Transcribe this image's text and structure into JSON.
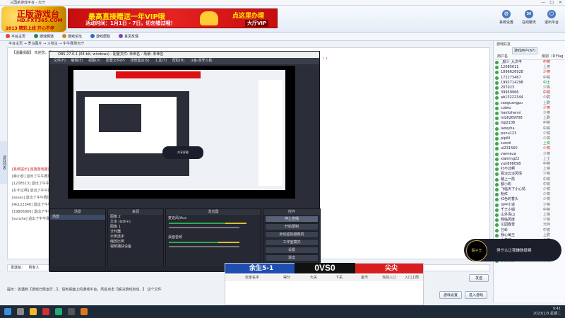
{
  "window": {
    "title": "三国杀游戏平台 - 大厅"
  },
  "logo": {
    "line1": "正版游戏台",
    "line2": "HD.FXT365.COM",
    "line3": "2013 精彩上线 开心不停"
  },
  "banner": {
    "headline": "最高直接赠送一年VIP哦",
    "subline": "活动时间：1月1日 - 7日，切勿错过哦！",
    "cta": "点这里办理",
    "cta2": "大厅VIP"
  },
  "toolbar": [
    {
      "label": "系统设置",
      "icon": "gear-icon"
    },
    {
      "label": "在线聊天",
      "icon": "chat-icon"
    },
    {
      "label": "退出平台",
      "icon": "power-icon"
    }
  ],
  "nav_tabs": [
    {
      "label": "平台主页",
      "color": "#e04a2a"
    },
    {
      "label": "游戏频道",
      "color": "#2a8a3a"
    },
    {
      "label": "游戏论坛",
      "color": "#d28a1a"
    },
    {
      "label": "游戏帮助",
      "color": "#2a6ad2"
    },
    {
      "label": "意见反馈",
      "color": "#8a3ac2"
    }
  ],
  "room": {
    "path": "平台主页 → 罗马图片 → 斗地主 → 牛牛赛场大厅"
  },
  "chat": {
    "notice": "【温馨提醒】 欢迎您，请多多支持我们的游戏平台",
    "red_notice": "请点击进入游戏房间入口！！！！",
    "lines": [
      "[系统提示] 连接游戏服务器成功",
      "[峰小影] 退出了牛牛赛场",
      "[1208513] 退出了牛牛赛场",
      "[打不过啊] 退出了牛牛赛场",
      "[sexes] 退出了牛牛赛场",
      "[4k122346] 退出了牛牛赛场",
      "[19806966] 退出了牛牛赛场",
      "[sunzhe] 退出了牛牛赛场"
    ],
    "input_label": "发送给：",
    "input_value": "所有人",
    "send": "发送",
    "tips": "提示：如遇到【游戏已经运行...】，请到桌面上的游戏平台，然后点击【解决游戏启动...】 这个文件",
    "set_button": "游戏设置",
    "help_button": "进入游戏"
  },
  "collapse_tab": "游戏列表",
  "right_panel": {
    "title": "游戏好友",
    "tabs": [
      "游戏用户(67)"
    ],
    "head": [
      "用户名",
      "级别",
      "ID",
      "Flag"
    ],
    "users": [
      {
        "name": "_颜少_九次丰",
        "level": "中将",
        "tone": "red"
      },
      {
        "name": "12085011",
        "level": "上将",
        "tone": ""
      },
      {
        "name": "1896626928",
        "level": "少将",
        "tone": "red"
      },
      {
        "name": "172273467",
        "level": "中将",
        "tone": ""
      },
      {
        "name": "1992714298",
        "level": "中士",
        "tone": "grn"
      },
      {
        "name": "207023",
        "level": "少将",
        "tone": ""
      },
      {
        "name": "39959966",
        "level": "中将",
        "tone": "red"
      },
      {
        "name": "ab13222344",
        "level": "少尉",
        "tone": ""
      },
      {
        "name": "caoguangpu",
        "level": "上尉",
        "tone": ""
      },
      {
        "name": "cuiwu",
        "level": "少将",
        "tone": "red"
      },
      {
        "name": "hanlizhenni",
        "level": "少将",
        "tone": ""
      },
      {
        "name": "hrb6269708",
        "level": "上尉",
        "tone": ""
      },
      {
        "name": "liqi2108",
        "level": "中将",
        "tone": ""
      },
      {
        "name": "laoxyha",
        "level": "中将",
        "tone": ""
      },
      {
        "name": "punu123",
        "level": "少将",
        "tone": ""
      },
      {
        "name": "pipilil",
        "level": "少将",
        "tone": ""
      },
      {
        "name": "sunzii",
        "level": "上将",
        "tone": "grn"
      },
      {
        "name": "ul231560",
        "level": "少将",
        "tone": "red"
      },
      {
        "name": "vanneua",
        "level": "少将",
        "tone": ""
      },
      {
        "name": "xiaming22",
        "level": "上士",
        "tone": ""
      },
      {
        "name": "yun898098",
        "level": "中将",
        "tone": ""
      },
      {
        "name": "打不过啊",
        "level": "上将",
        "tone": ""
      },
      {
        "name": "看淡云淡风情",
        "level": "少将",
        "tone": ""
      },
      {
        "name": "赌上一局",
        "level": "中将",
        "tone": ""
      },
      {
        "name": "都小影",
        "level": "中将",
        "tone": ""
      },
      {
        "name": "飞临天下小心情",
        "level": "少将",
        "tone": ""
      },
      {
        "name": "粉红",
        "level": "少将",
        "tone": ""
      },
      {
        "name": "红色的香头",
        "level": "少将",
        "tone": ""
      },
      {
        "name": "马中小道",
        "level": "少将",
        "tone": ""
      },
      {
        "name": "千王小娟",
        "level": "中将",
        "tone": ""
      },
      {
        "name": "山外青山",
        "level": "上将",
        "tone": ""
      },
      {
        "name": "我临风度",
        "level": "少将",
        "tone": ""
      },
      {
        "name": "沁园春雪",
        "level": "元帅",
        "tone": ""
      },
      {
        "name": "万岭",
        "level": "中将",
        "tone": ""
      },
      {
        "name": "我心每王",
        "level": "上尉",
        "tone": ""
      },
      {
        "name": "小李家",
        "level": "少将",
        "tone": ""
      },
      {
        "name": "小大红",
        "level": "中将",
        "tone": ""
      },
      {
        "name": "小丢丢",
        "level": "元帅",
        "tone": ""
      },
      {
        "name": "小天12",
        "level": "少将",
        "tone": ""
      },
      {
        "name": "李兼元静",
        "level": "中将",
        "tone": ""
      }
    ]
  },
  "obs": {
    "title": "OBS 27.0.1 (64-bit, windows) - 配置文件: 未命名 - 场景: 未命名",
    "menu": [
      "文件(F)",
      "编辑(E)",
      "视图(V)",
      "配置文件(P)",
      "场景集合(S)",
      "工具(T)",
      "帮助(H)",
      "斗鱼·虎牙小助"
    ],
    "preview_label": "共享屏幕",
    "docks": {
      "scenes": {
        "title": "场景",
        "items": [
          "场景"
        ]
      },
      "sources": {
        "title": "来源",
        "items": [
          "图像 2",
          "文本 (GDI+)",
          "图像 1",
          "计时器",
          "示例选手",
          "缩放比例",
          "视频捕获设备"
        ]
      },
      "mixer": {
        "title": "混音器",
        "tracks": [
          "麦克风/Aux",
          "桌面音频"
        ]
      },
      "controls": {
        "title": "控件",
        "buttons": [
          "停止直播",
          "开始录制",
          "启动虚拟摄像机",
          "工作室模式",
          "设置",
          "退出"
        ]
      }
    },
    "status": "LIVE: 00:00:00  REC: 00:00:00  CPU: 1.2%  30.00 fps"
  },
  "scoreboard": {
    "left": "余生5-1",
    "score": "0VS0",
    "right": "尖尖",
    "columns": [
      "玩家名字",
      "得分",
      "大关",
      "下关",
      "金币",
      "当前入口",
      "入口上限"
    ]
  },
  "overlay_tip": {
    "badge": "骰子王",
    "text": "但什么让我嫌骸投嘛"
  },
  "clock": {
    "time": "9:41",
    "date": "2023/1/3 星期二"
  }
}
